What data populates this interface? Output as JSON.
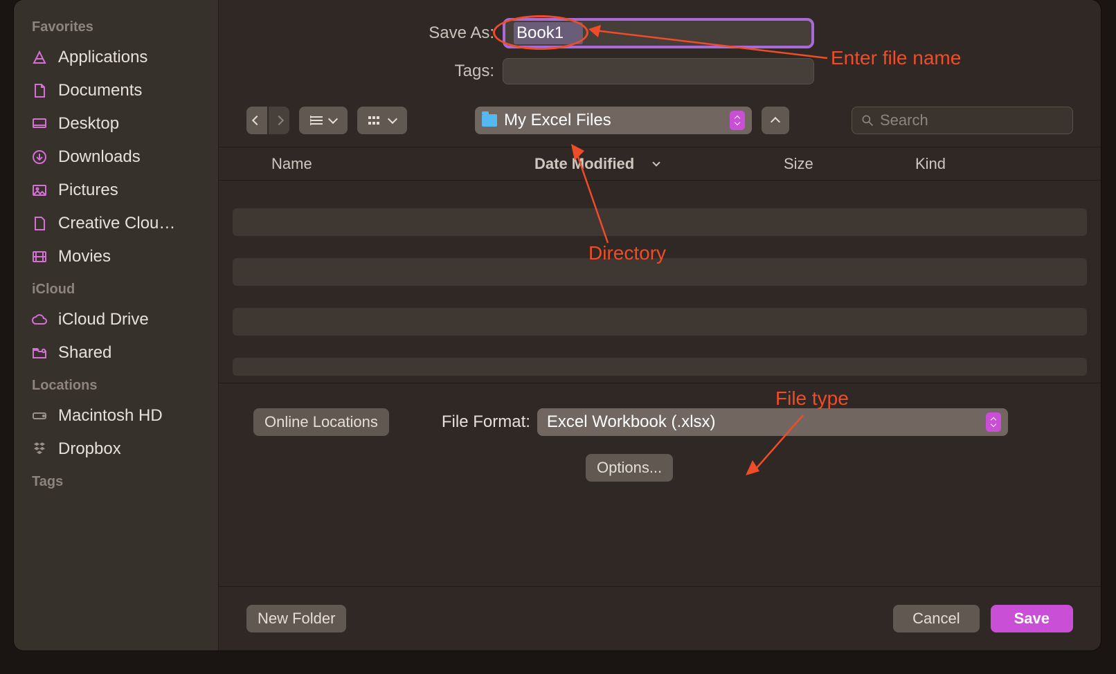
{
  "form": {
    "save_as_label": "Save As:",
    "save_as_value": "Book1",
    "tags_label": "Tags:"
  },
  "toolbar": {
    "directory": "My Excel Files",
    "search_placeholder": "Search"
  },
  "columns": {
    "name": "Name",
    "date": "Date Modified",
    "size": "Size",
    "kind": "Kind"
  },
  "bottom": {
    "online_locations": "Online Locations",
    "file_format_label": "File Format:",
    "file_format_value": "Excel Workbook (.xlsx)",
    "options": "Options..."
  },
  "actions": {
    "new_folder": "New Folder",
    "cancel": "Cancel",
    "save": "Save"
  },
  "sidebar": {
    "favorites_title": "Favorites",
    "icloud_title": "iCloud",
    "locations_title": "Locations",
    "tags_title": "Tags",
    "favorites": [
      {
        "label": "Applications",
        "icon": "apps"
      },
      {
        "label": "Documents",
        "icon": "doc"
      },
      {
        "label": "Desktop",
        "icon": "desktop"
      },
      {
        "label": "Downloads",
        "icon": "download"
      },
      {
        "label": "Pictures",
        "icon": "pictures"
      },
      {
        "label": "Creative Clou…",
        "icon": "file"
      },
      {
        "label": "Movies",
        "icon": "movies"
      }
    ],
    "icloud": [
      {
        "label": "iCloud Drive",
        "icon": "cloud"
      },
      {
        "label": "Shared",
        "icon": "shared"
      }
    ],
    "locations": [
      {
        "label": "Macintosh HD",
        "icon": "hdd"
      },
      {
        "label": "Dropbox",
        "icon": "dropbox"
      }
    ]
  },
  "annotations": {
    "file_name": "Enter file name",
    "directory": "Directory",
    "file_type": "File type"
  }
}
